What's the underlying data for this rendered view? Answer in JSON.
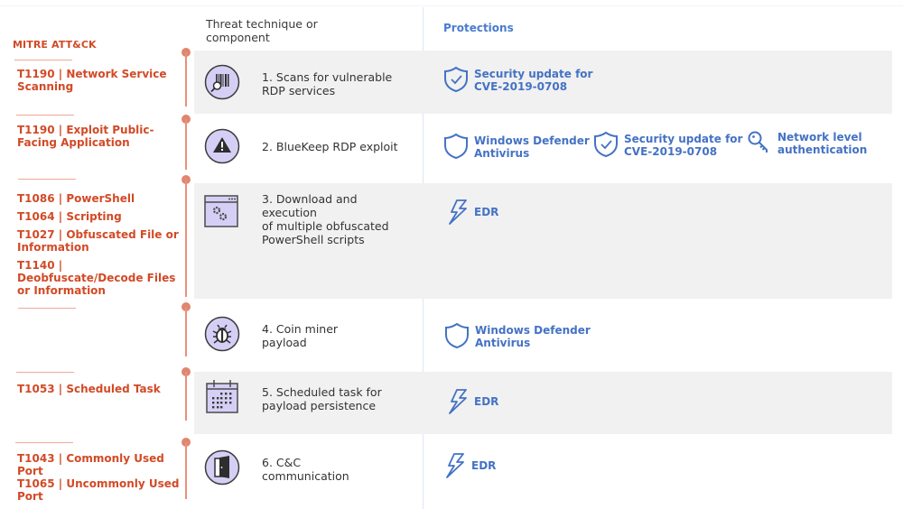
{
  "headers": {
    "mitre": "MITRE ATT&CK",
    "technique_line1": "Threat technique or",
    "technique_line2": "component",
    "protections": "Protections"
  },
  "colors": {
    "mitre_red": "#d24a26",
    "timeline": "#e0866f",
    "protection_blue": "#4472c4",
    "icon_fill": "#d6cff5",
    "band_grey": "#f1f1f1"
  },
  "rows": [
    {
      "mitre": [
        "T1190 | Network Service Scanning"
      ],
      "step_line1": "1. Scans for vulnerable",
      "step_line2": "RDP services",
      "icon": "barcode-scan-icon",
      "protections": [
        {
          "icon": "shield-check-icon",
          "line1": "Security update for",
          "line2": "CVE-2019-0708"
        }
      ]
    },
    {
      "mitre": [
        "T1190 | Exploit Public-Facing Application"
      ],
      "step_line1": "2. BlueKeep RDP exploit",
      "step_line2": "",
      "icon": "warning-icon",
      "protections": [
        {
          "icon": "shield-icon",
          "line1": "Windows Defender",
          "line2": "Antivirus"
        },
        {
          "icon": "shield-check-icon",
          "line1": "Security update for",
          "line2": "CVE-2019-0708"
        },
        {
          "icon": "key-icon",
          "line1": "Network level",
          "line2": "authentication"
        }
      ]
    },
    {
      "mitre": [
        "T1086 | PowerShell",
        "T1064 | Scripting",
        "T1027 | Obfuscated File or Information",
        "T1140 | Deobfuscate/Decode Files or Information"
      ],
      "step_line1": "3. Download and execution",
      "step_line2": "of multiple obfuscated",
      "step_line3": "PowerShell scripts",
      "icon": "script-window-gears-icon",
      "protections": [
        {
          "icon": "lightning-icon",
          "line1": "EDR"
        }
      ]
    },
    {
      "mitre": [],
      "step_line1": "4. Coin miner",
      "step_line2": "payload",
      "icon": "bug-icon",
      "protections": [
        {
          "icon": "shield-icon",
          "line1": "Windows Defender",
          "line2": "Antivirus"
        }
      ]
    },
    {
      "mitre": [
        "T1053 | Scheduled Task"
      ],
      "step_line1": "5. Scheduled task for",
      "step_line2": "payload persistence",
      "icon": "calendar-icon",
      "protections": [
        {
          "icon": "lightning-icon",
          "line1": "EDR"
        }
      ]
    },
    {
      "mitre": [
        "T1043 | Commonly Used Port",
        "T1065 | Uncommonly Used Port"
      ],
      "step_line1": "6. C&C",
      "step_line2": "communication",
      "icon": "open-door-icon",
      "protections": [
        {
          "icon": "lightning-icon",
          "line1": "EDR"
        }
      ]
    }
  ]
}
